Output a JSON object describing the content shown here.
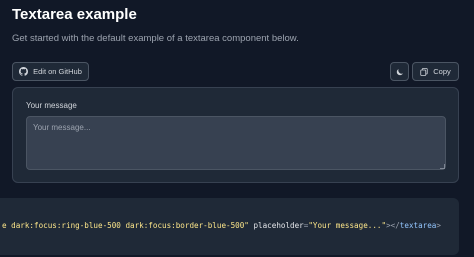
{
  "header": {
    "title": "Textarea example",
    "subtitle": "Get started with the default example of a textarea component below."
  },
  "toolbar": {
    "github_label": "Edit on GitHub",
    "copy_label": "Copy",
    "theme_icon": "moon-icon",
    "github_icon": "github-icon",
    "copy_icon": "copy-icon"
  },
  "preview": {
    "label": "Your message",
    "textarea_placeholder": "Your message...",
    "textarea_value": ""
  },
  "code": {
    "part1": "e dark:focus:ring-blue-500 dark:focus:border-blue-500\"",
    "part2": " placeholder",
    "part3": "=",
    "part4": "\"Your message...\"",
    "part5": "></",
    "part6": "textarea",
    "part7": ">"
  },
  "colors": {
    "background": "#111827",
    "panel": "#1f2937",
    "field": "#374151",
    "border": "#4b5563"
  }
}
